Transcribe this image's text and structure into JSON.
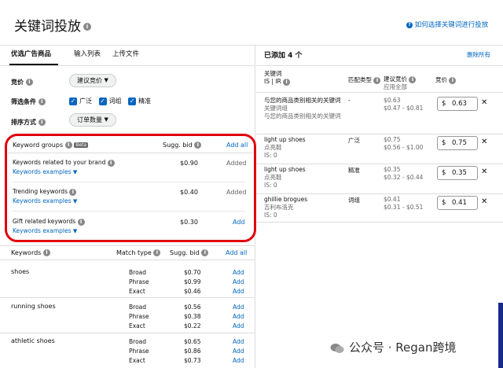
{
  "header": {
    "title": "关键词投放",
    "help_link": "如何选择关键词进行投放"
  },
  "tabs": [
    {
      "label": "优选广告商品"
    },
    {
      "label": "输入列表"
    },
    {
      "label": "上传文件"
    }
  ],
  "filters": {
    "bid_label": "竞价",
    "bid_value": "建议竞价",
    "filter_label": "筛选条件",
    "match_types": [
      "广泛",
      "词组",
      "精准"
    ],
    "sort_label": "排序方式",
    "sort_value": "订单数量"
  },
  "groups": {
    "header_label": "Keyword groups",
    "beta": "Beta",
    "sugg_bid_label": "Sugg. bid",
    "add_all": "Add all",
    "items": [
      {
        "name": "Keywords related to your brand",
        "examples": "Keywords examples",
        "bid": "$0.90",
        "status": "Added"
      },
      {
        "name": "Trending keywords",
        "examples": "Keywords examples",
        "bid": "$0.40",
        "status": "Added"
      },
      {
        "name": "Gift related keywords",
        "examples": "Keywords examples",
        "bid": "$0.30",
        "status": "Add"
      }
    ]
  },
  "keywords": {
    "header_label": "Keywords",
    "match_type_label": "Match type",
    "sugg_bid_label": "Sugg. bid",
    "add_all": "Add all",
    "add": "Add",
    "rows": [
      {
        "keyword": "shoes",
        "types": [
          "Broad",
          "Phrase",
          "Exact"
        ],
        "bids": [
          "$0.70",
          "$0.99",
          "$0.46"
        ]
      },
      {
        "keyword": "running shoes",
        "types": [
          "Broad",
          "Phrase",
          "Exact"
        ],
        "bids": [
          "$0.56",
          "$0.38",
          "$0.22"
        ]
      },
      {
        "keyword": "athletic shoes",
        "types": [
          "Broad",
          "Phrase",
          "Exact"
        ],
        "bids": [
          "$0.65",
          "$0.86",
          "$0.73"
        ]
      }
    ]
  },
  "added": {
    "title": "已添加 4 个",
    "delete_all": "删除所有",
    "col_keyword": "关键词",
    "col_keyword_sub": "IS | IR",
    "col_match": "匹配类型",
    "col_sugg": "建议竞价",
    "col_sugg_sub": "应用全部",
    "col_bid": "竞价",
    "rows": [
      {
        "keyword": "与您的商品类别相关的关键词",
        "sub1": "关键词组",
        "sub2": "与您的商品类别相关的关键词",
        "match": "-",
        "sugg": "$0.63",
        "range": "$0.47 - $0.81",
        "bid": "0.63"
      },
      {
        "keyword": "light up shoes",
        "sub1": "点亮鞋",
        "sub2": "IS: 0",
        "match": "广泛",
        "sugg": "$0.75",
        "range": "$0.56 - $1.00",
        "bid": "0.75"
      },
      {
        "keyword": "light up shoes",
        "sub1": "点亮鞋",
        "sub2": "IS: 0",
        "match": "精准",
        "sugg": "$0.35",
        "range": "$0.32 - $0.44",
        "bid": "0.35"
      },
      {
        "keyword": "ghillie brogues",
        "sub1": "吉利布洛克",
        "sub2": "IS: 0",
        "match": "词组",
        "sugg": "$0.41",
        "range": "$0.31 - $0.51",
        "bid": "0.41"
      }
    ],
    "currency": "$",
    "remove": "✕"
  },
  "watermark": "公众号 · Regan跨境"
}
